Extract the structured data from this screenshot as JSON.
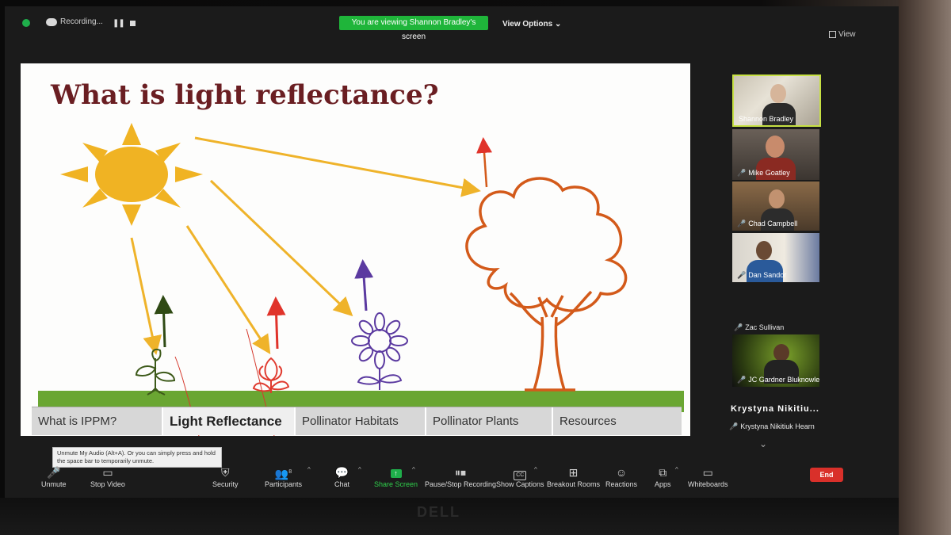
{
  "topbar": {
    "recording_label": "Recording...",
    "viewing_banner": "You are viewing Shannon Bradley's screen",
    "view_options": "View Options",
    "view_button": "View"
  },
  "slide": {
    "title": "What is light reflectance?",
    "tabs": [
      {
        "label": "What is IPPM?",
        "active": false
      },
      {
        "label": "Light Reflectance",
        "active": true
      },
      {
        "label": "Pollinator Habitats",
        "active": false
      },
      {
        "label": "Pollinator Plants",
        "active": false
      },
      {
        "label": "Resources",
        "active": false
      }
    ],
    "colors": {
      "title": "#6a1e22",
      "sun": "#f0b323",
      "ground": "#6aa632",
      "tree": "#d35a1a",
      "flower": "#5b3aa0",
      "red_flower": "#e03a2e",
      "sprout": "#3d5a1a"
    }
  },
  "participants": {
    "tiles": [
      {
        "name": "Shannon Bradley",
        "muted": false,
        "active_speaker": true
      },
      {
        "name": "Mike Goatley",
        "muted": true
      },
      {
        "name": "Chad Campbell",
        "muted": true
      },
      {
        "name": "Dan Sandor",
        "muted": true
      }
    ],
    "zac": {
      "name": "Zac Sullivan"
    },
    "jc": {
      "name": "JC Gardner Bluknowle..."
    },
    "krystyna_short": "Krystyna Nikitiu...",
    "krystyna_full": "Krystyna Nikitiuk Hearn"
  },
  "tooltip": "Unmute My Audio (Alt+A). Or you can simply press and hold the space bar to temporarily unmute.",
  "toolbar": {
    "unmute": "Unmute",
    "stop_video": "Stop Video",
    "security": "Security",
    "participants": "Participants",
    "participants_count": "8",
    "chat": "Chat",
    "share_screen": "Share Screen",
    "pause_recording": "Pause/Stop Recording",
    "captions": "Show Captions",
    "captions_icon": "CC",
    "breakout": "Breakout Rooms",
    "reactions": "Reactions",
    "apps": "Apps",
    "whiteboards": "Whiteboards",
    "end": "End"
  },
  "monitor_brand": "DELL"
}
